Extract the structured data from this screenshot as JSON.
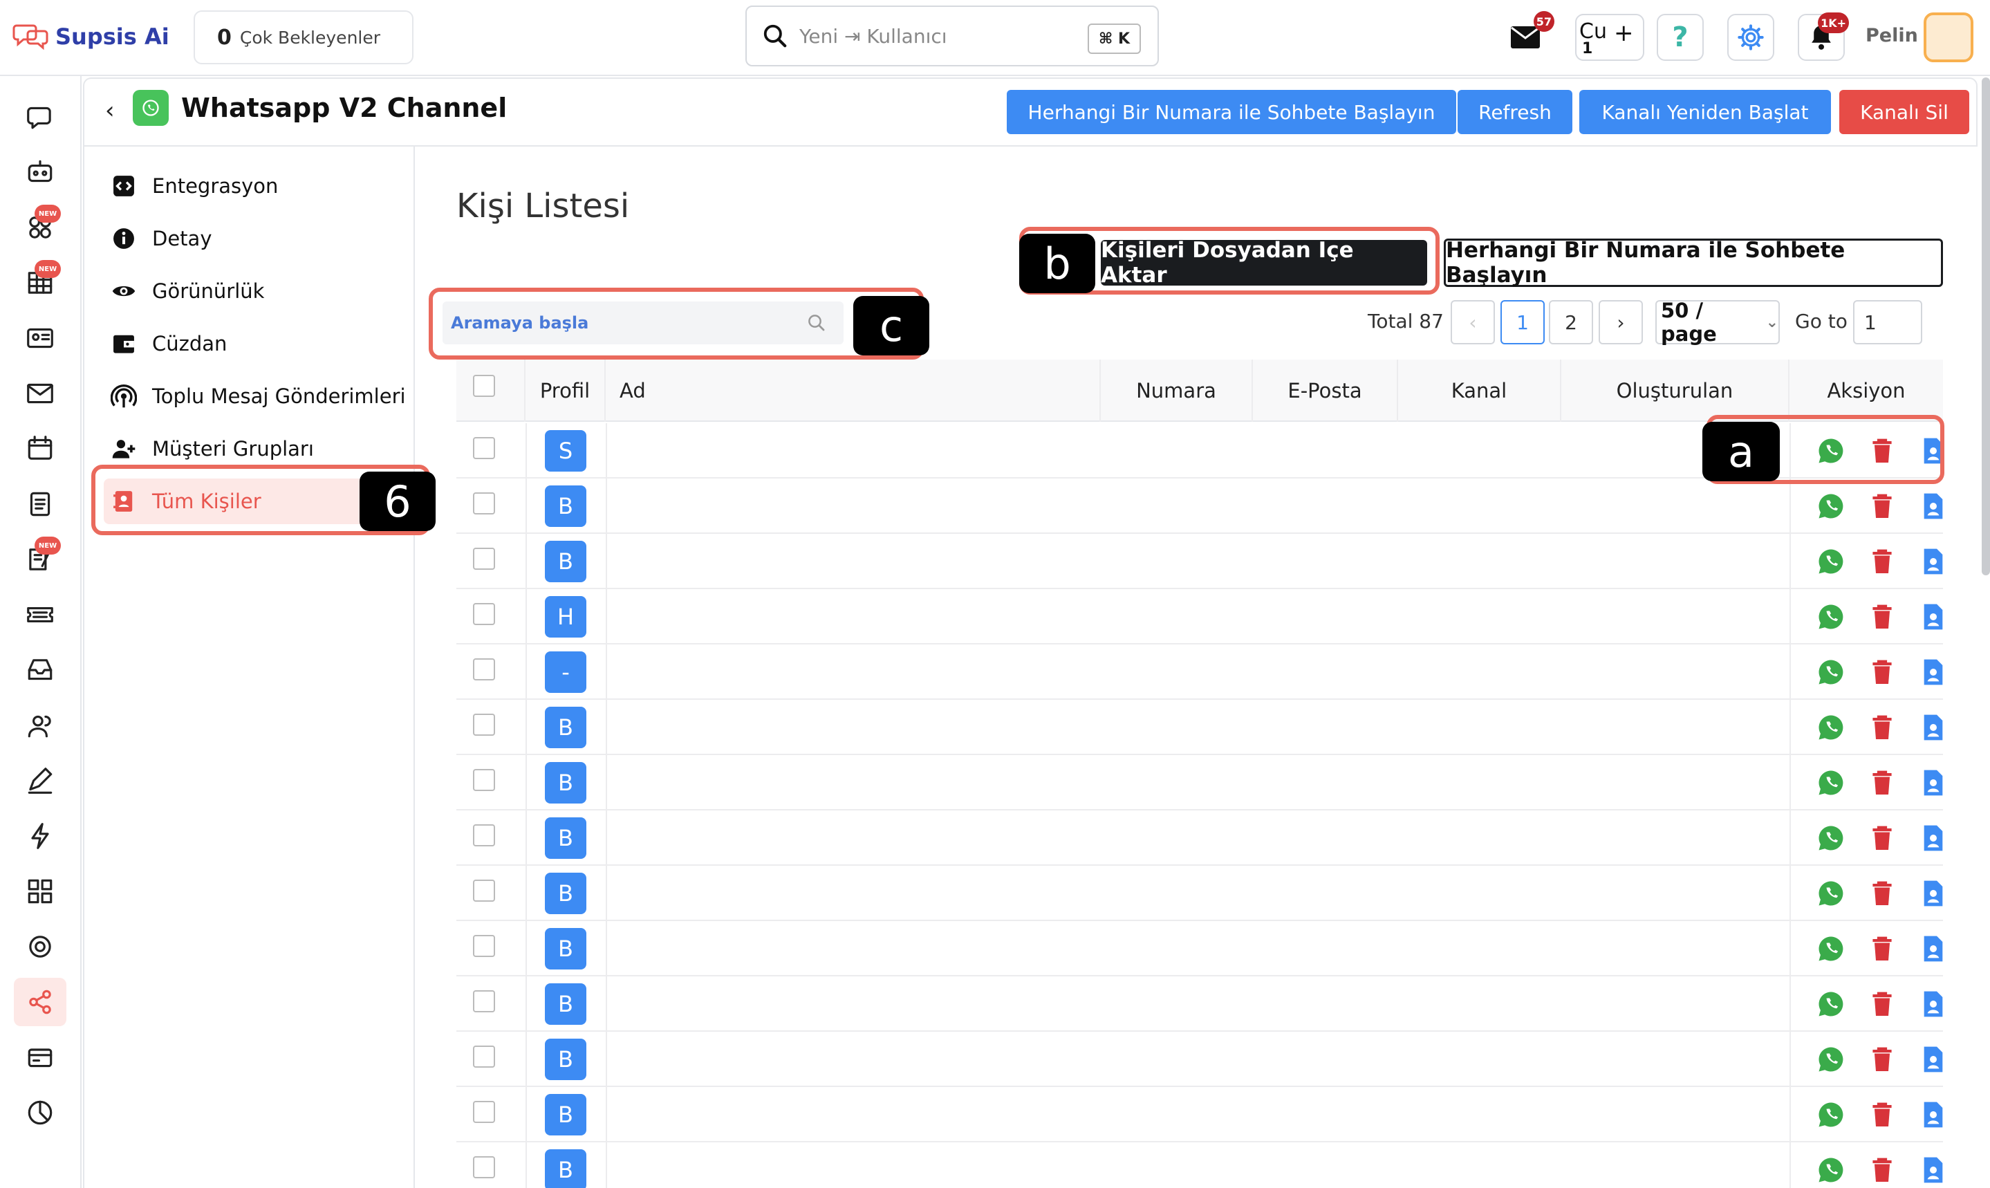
{
  "app": {
    "name": "Supsis Ai",
    "accent": "#e8554e",
    "brand": "#2f3fa8"
  },
  "topbar": {
    "pending_count": "0",
    "pending_label": "Çok Bekleyenler",
    "search_placeholder": "Yeni ⇥ Kullanıcı",
    "shortcut": "⌘ K",
    "mail_badge": "57",
    "status_text": "Cu",
    "status_sub": "1",
    "notif_badge": "1K+",
    "user_name": "Pelin"
  },
  "rail": {
    "icons": [
      "chat-icon",
      "bot-icon",
      "integrations-icon",
      "table-icon",
      "contact-card-icon",
      "mail-icon",
      "calendar-icon",
      "list-icon",
      "notes-icon",
      "ticket-icon",
      "inbox-icon",
      "users-icon",
      "edit-icon",
      "flash-icon",
      "apps-icon",
      "settings-icon",
      "share-icon",
      "payment-icon",
      "report-icon"
    ],
    "new_label": "NEW"
  },
  "header": {
    "title": "Whatsapp V2 Channel",
    "btn_start_chat": "Herhangi Bir Numara ile Sohbete Başlayın",
    "btn_refresh": "Refresh",
    "btn_restart": "Kanalı Yeniden Başlat",
    "btn_delete": "Kanalı Sil"
  },
  "subnav": {
    "items": [
      {
        "label": "Entegrasyon",
        "icon": "code-icon"
      },
      {
        "label": "Detay",
        "icon": "info-icon"
      },
      {
        "label": "Görünürlük",
        "icon": "eye-icon"
      },
      {
        "label": "Cüzdan",
        "icon": "wallet-icon"
      },
      {
        "label": "Toplu Mesaj Gönderimleri",
        "icon": "broadcast-icon"
      },
      {
        "label": "Müşteri Grupları",
        "icon": "user-group-icon"
      },
      {
        "label": "Tüm Kişiler",
        "icon": "contact-book-icon"
      }
    ]
  },
  "main": {
    "section_title": "Kişi Listesi",
    "import_button": "Kişileri Dosyadan İçe Aktar",
    "start_chat_button": "Herhangi Bir Numara ile Sohbete Başlayın",
    "search_placeholder": "Aramaya başla",
    "pagination": {
      "total": "Total 87",
      "pages": [
        "1",
        "2"
      ],
      "page_size": "50 / page",
      "goto_label": "Go to",
      "goto_value": "1"
    }
  },
  "markers": {
    "a": "a",
    "b": "b",
    "c": "c",
    "six": "6"
  },
  "table": {
    "columns": [
      "Profil",
      "Ad",
      "Numara",
      "E-Posta",
      "Kanal",
      "Oluşturulan",
      "Aksiyon"
    ],
    "rows": [
      "S",
      "B",
      "B",
      "H",
      "-",
      "B",
      "B",
      "B",
      "B",
      "B",
      "B",
      "B",
      "B",
      "B"
    ]
  }
}
